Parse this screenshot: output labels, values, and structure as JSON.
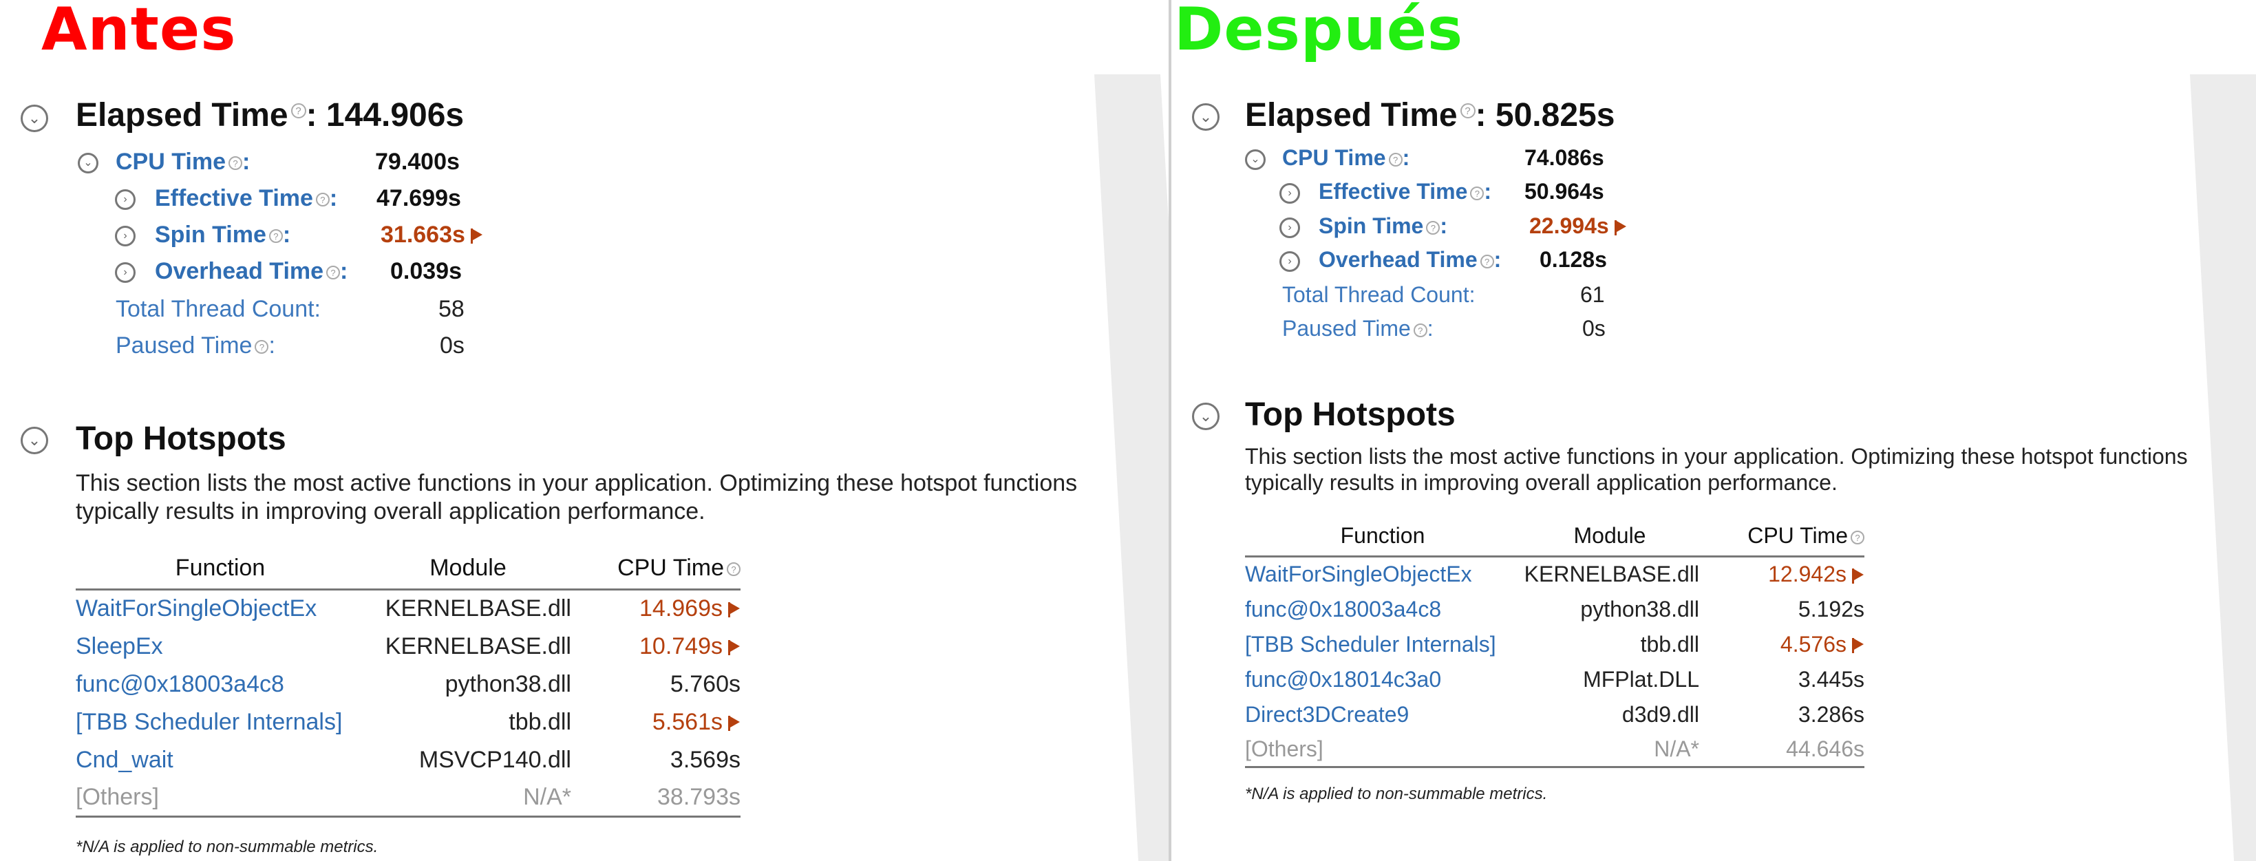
{
  "before": {
    "label": "Antes",
    "label_color": "#ff0000",
    "elapsed": {
      "title": "Elapsed Time",
      "value": ": 144.906s"
    },
    "cpu_time": {
      "label": "CPU Time",
      "value": "79.400s"
    },
    "effective_time": {
      "label": "Effective Time",
      "value": "47.699s"
    },
    "spin_time": {
      "label": "Spin Time",
      "value": "31.663s"
    },
    "overhead_time": {
      "label": "Overhead Time",
      "value": "0.039s"
    },
    "thread_count": {
      "label": "Total Thread Count:",
      "value": "58"
    },
    "paused_time": {
      "label": "Paused Time",
      "value": "0s"
    },
    "hotspots": {
      "title": "Top Hotspots",
      "description": "This section lists the most active functions in your application. Optimizing these hotspot functions typically results in improving overall application performance.",
      "columns": [
        "Function",
        "Module",
        "CPU Time"
      ],
      "rows": [
        {
          "function": "WaitForSingleObjectEx",
          "module": "KERNELBASE.dll",
          "cpu": "14.969s",
          "flag": true
        },
        {
          "function": "SleepEx",
          "module": "KERNELBASE.dll",
          "cpu": "10.749s",
          "flag": true
        },
        {
          "function": "func@0x18003a4c8",
          "module": "python38.dll",
          "cpu": "5.760s",
          "flag": false
        },
        {
          "function": "[TBB Scheduler Internals]",
          "module": "tbb.dll",
          "cpu": "5.561s",
          "flag": true
        },
        {
          "function": "Cnd_wait",
          "module": "MSVCP140.dll",
          "cpu": "3.569s",
          "flag": false
        },
        {
          "function": "[Others]",
          "module": "N/A*",
          "cpu": "38.793s",
          "flag": false
        }
      ],
      "footnote": "*N/A is applied to non-summable metrics."
    }
  },
  "after": {
    "label": "Después",
    "label_color": "#22ee11",
    "elapsed": {
      "title": "Elapsed Time",
      "value": ": 50.825s"
    },
    "cpu_time": {
      "label": "CPU Time",
      "value": "74.086s"
    },
    "effective_time": {
      "label": "Effective Time",
      "value": "50.964s"
    },
    "spin_time": {
      "label": "Spin Time",
      "value": "22.994s"
    },
    "overhead_time": {
      "label": "Overhead Time",
      "value": "0.128s"
    },
    "thread_count": {
      "label": "Total Thread Count:",
      "value": "61"
    },
    "paused_time": {
      "label": "Paused Time",
      "value": "0s"
    },
    "hotspots": {
      "title": "Top Hotspots",
      "description": "This section lists the most active functions in your application. Optimizing these hotspot functions typically results in improving overall application performance.",
      "columns": [
        "Function",
        "Module",
        "CPU Time"
      ],
      "rows": [
        {
          "function": "WaitForSingleObjectEx",
          "module": "KERNELBASE.dll",
          "cpu": "12.942s",
          "flag": true
        },
        {
          "function": "func@0x18003a4c8",
          "module": "python38.dll",
          "cpu": "5.192s",
          "flag": false
        },
        {
          "function": "[TBB Scheduler Internals]",
          "module": "tbb.dll",
          "cpu": "4.576s",
          "flag": true
        },
        {
          "function": "func@0x18014c3a0",
          "module": "MFPlat.DLL",
          "cpu": "3.445s",
          "flag": false
        },
        {
          "function": "Direct3DCreate9",
          "module": "d3d9.dll",
          "cpu": "3.286s",
          "flag": false
        },
        {
          "function": "[Others]",
          "module": "N/A*",
          "cpu": "44.646s",
          "flag": false
        }
      ],
      "footnote": "*N/A is applied to non-summable metrics."
    }
  },
  "icons": {
    "expand": "expand-circle-icon",
    "collapse": "collapse-circle-icon",
    "help": "help-question-icon",
    "flag": "warning-flag-icon"
  },
  "colors": {
    "link": "#2f6db3",
    "warning": "#b5400e",
    "muted": "#999999"
  }
}
